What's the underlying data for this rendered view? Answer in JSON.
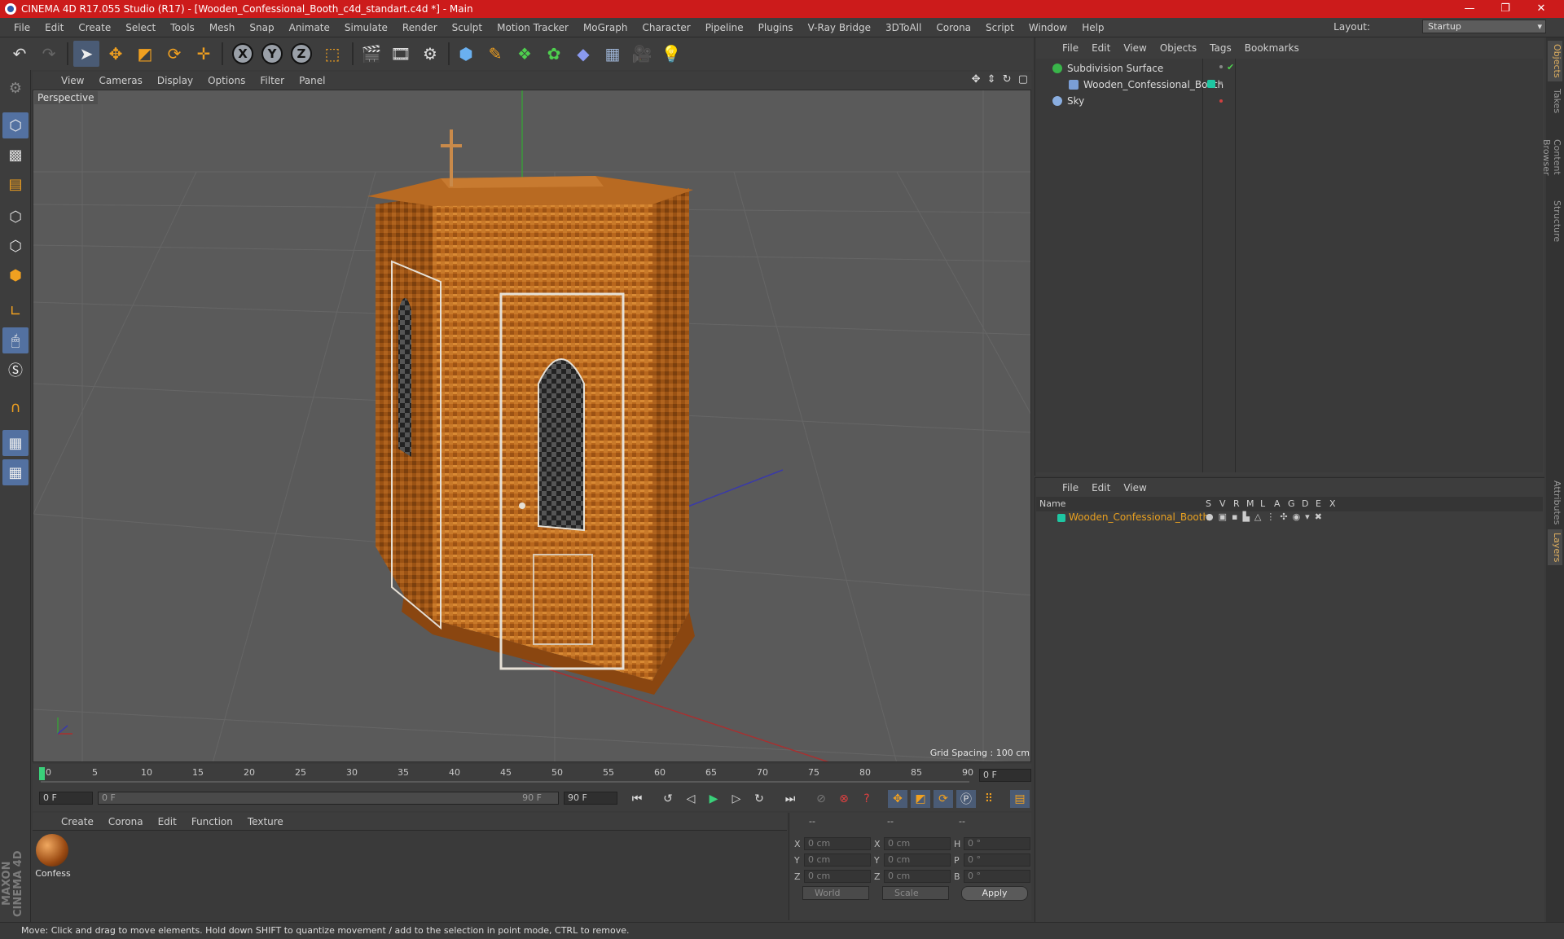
{
  "window": {
    "title": "CINEMA 4D R17.055 Studio (R17) - [Wooden_Confessional_Booth_c4d_standart.c4d *] - Main",
    "minimize": "—",
    "maximize": "❐",
    "close": "✕"
  },
  "menubar": [
    "File",
    "Edit",
    "Create",
    "Select",
    "Tools",
    "Mesh",
    "Snap",
    "Animate",
    "Simulate",
    "Render",
    "Sculpt",
    "Motion Tracker",
    "MoGraph",
    "Character",
    "Pipeline",
    "Plugins",
    "V-Ray Bridge",
    "3DToAll",
    "Corona",
    "Script",
    "Window",
    "Help"
  ],
  "layout": {
    "label": "Layout:",
    "value": "Startup"
  },
  "toolbar": {
    "axis_x": "X",
    "axis_y": "Y",
    "axis_z": "Z"
  },
  "viewport": {
    "menu": [
      "View",
      "Cameras",
      "Display",
      "Options",
      "Filter",
      "Panel"
    ],
    "label": "Perspective",
    "grid_spacing": "Grid Spacing : 100 cm",
    "nav_icons": "✥ ⇕ ↻ ▢"
  },
  "timeline": {
    "ticks": [
      "0",
      "5",
      "10",
      "15",
      "20",
      "25",
      "30",
      "35",
      "40",
      "45",
      "50",
      "55",
      "60",
      "65",
      "70",
      "75",
      "80",
      "85",
      "90"
    ],
    "current_frame": "0 F",
    "start_field": "0 F",
    "range_start": "0 F",
    "range_end": "90 F",
    "end_field": "90 F"
  },
  "materials": {
    "menu": [
      "Create",
      "Corona",
      "Edit",
      "Function",
      "Texture"
    ],
    "items": [
      {
        "name": "Confess"
      }
    ]
  },
  "coordinates": {
    "header": [
      "--",
      "--",
      "--"
    ],
    "rows": [
      {
        "pos_label": "X",
        "pos": "0 cm",
        "size_label": "X",
        "size": "0 cm",
        "rot_label": "H",
        "rot": "0 °"
      },
      {
        "pos_label": "Y",
        "pos": "0 cm",
        "size_label": "Y",
        "size": "0 cm",
        "rot_label": "P",
        "rot": "0 °"
      },
      {
        "pos_label": "Z",
        "pos": "0 cm",
        "size_label": "Z",
        "size": "0 cm",
        "rot_label": "B",
        "rot": "0 °"
      }
    ],
    "space": "World",
    "mode": "Scale",
    "apply": "Apply"
  },
  "objects": {
    "menu": [
      "File",
      "Edit",
      "View",
      "Objects",
      "Tags",
      "Bookmarks"
    ],
    "items": [
      {
        "name": "Subdivision Surface",
        "icon_color": "#39b54a"
      },
      {
        "name": "Wooden_Confessional_Booth",
        "icon_color": "#7a9ed6"
      },
      {
        "name": "Sky",
        "icon_color": "#8aaee0"
      }
    ]
  },
  "layers": {
    "menu": [
      "File",
      "Edit",
      "View"
    ],
    "columns": [
      "Name",
      "S",
      "V",
      "R",
      "M",
      "L",
      "A",
      "G",
      "D",
      "E",
      "X"
    ],
    "items": [
      {
        "name": "Wooden_Confessional_Booth",
        "color": "#1ec6a2"
      }
    ]
  },
  "side_tabs": [
    "Objects",
    "Takes",
    "Content Browser",
    "Structure",
    "Attributes",
    "Layers"
  ],
  "status": "Move: Click and drag to move elements. Hold down SHIFT to quantize movement / add to the selection in point mode, CTRL to remove.",
  "brand": "MAXON CINEMA 4D",
  "colors": {
    "title_bar": "#cc1b1b",
    "accent_orange": "#e8a020",
    "highlight_blue": "#5371a1"
  }
}
